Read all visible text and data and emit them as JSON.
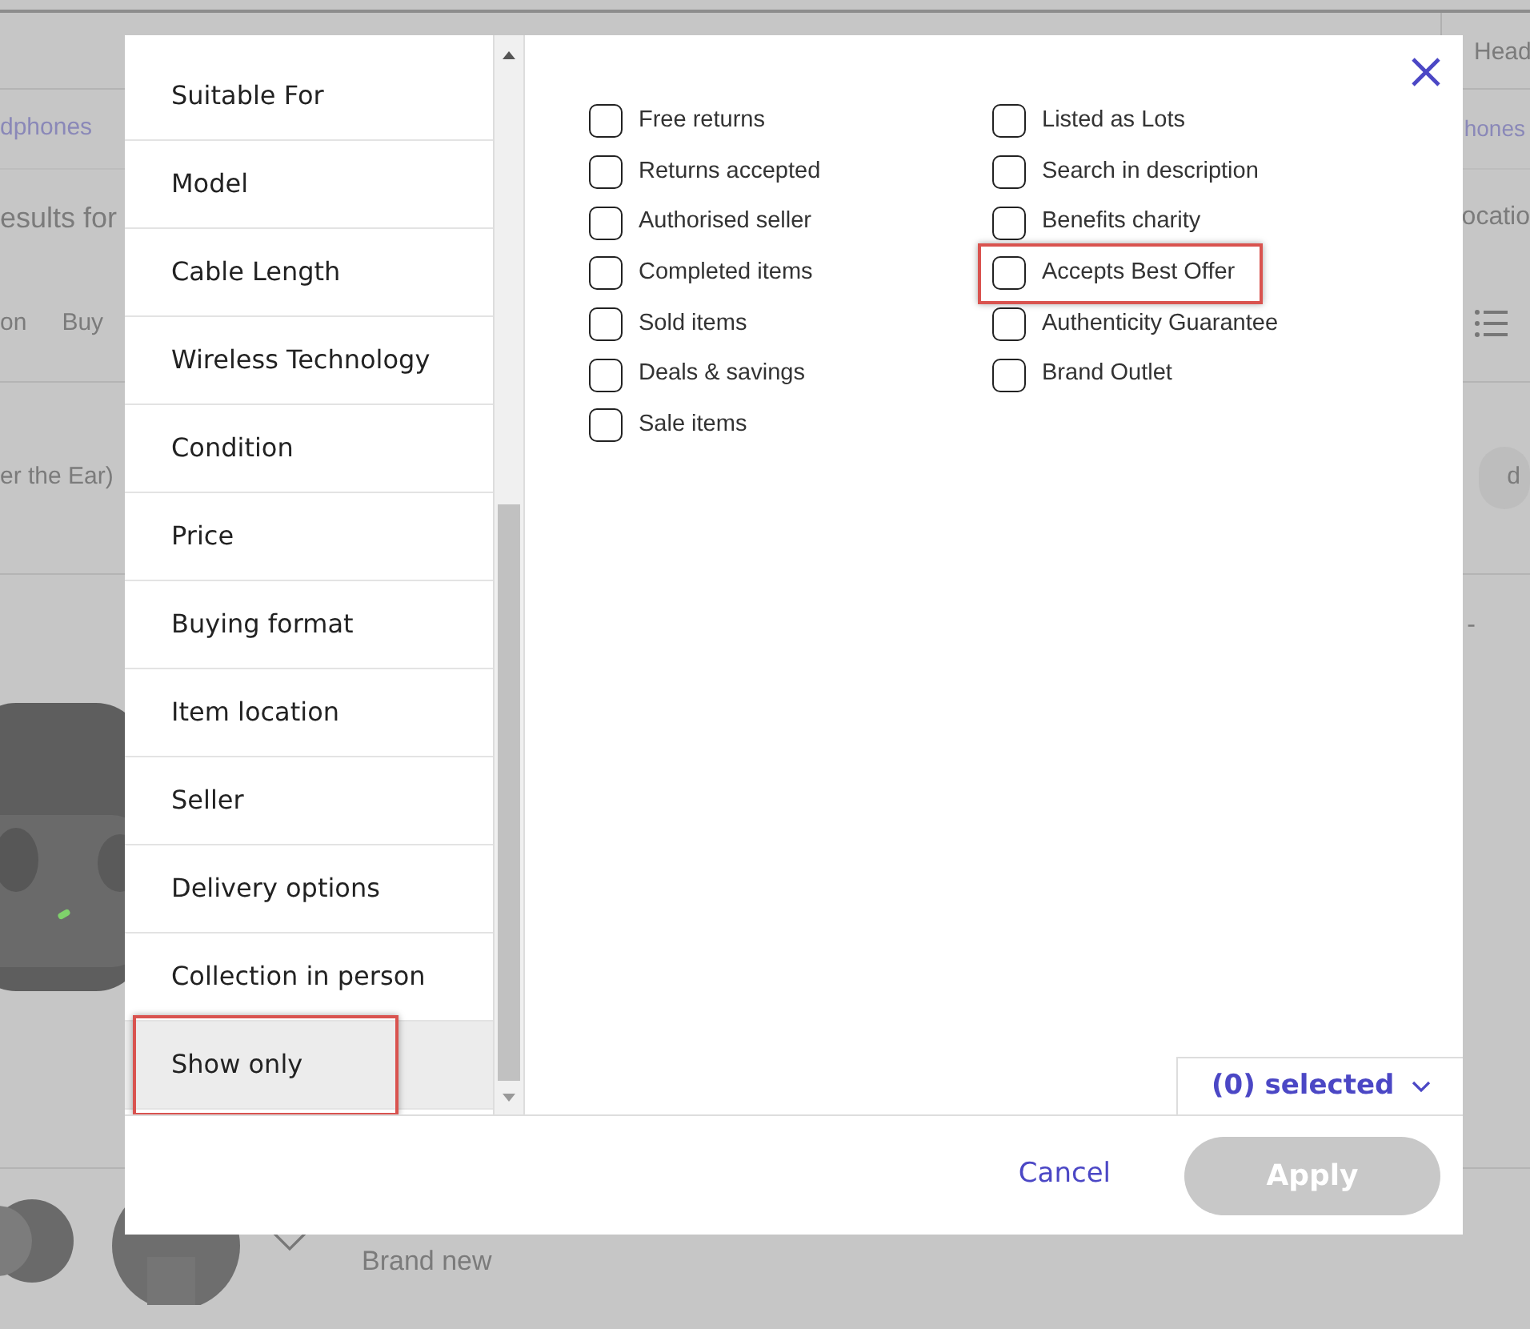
{
  "background_page": {
    "header_text": "Head",
    "links": [
      "dphones",
      "hones"
    ],
    "heading": "esults for",
    "heading_right": "ocatio",
    "tabs": [
      "on",
      "Buy"
    ],
    "chip_left": "er the Ear)",
    "chip_right": "d",
    "dash": "-",
    "condition": "Brand new"
  },
  "dialog": {
    "categories": [
      {
        "label": "Suitable For",
        "selected": false,
        "highlighted": false
      },
      {
        "label": "Model",
        "selected": false,
        "highlighted": false
      },
      {
        "label": "Cable Length",
        "selected": false,
        "highlighted": false
      },
      {
        "label": "Wireless Technology",
        "selected": false,
        "highlighted": false
      },
      {
        "label": "Condition",
        "selected": false,
        "highlighted": false
      },
      {
        "label": "Price",
        "selected": false,
        "highlighted": false
      },
      {
        "label": "Buying format",
        "selected": false,
        "highlighted": false
      },
      {
        "label": "Item location",
        "selected": false,
        "highlighted": false
      },
      {
        "label": "Seller",
        "selected": false,
        "highlighted": false
      },
      {
        "label": "Delivery options",
        "selected": false,
        "highlighted": false
      },
      {
        "label": "Collection in person",
        "selected": false,
        "highlighted": false
      },
      {
        "label": "Show only",
        "selected": true,
        "highlighted": true
      }
    ],
    "option_columns": [
      [
        {
          "label": "Free returns",
          "checked": false,
          "highlighted": false
        },
        {
          "label": "Returns accepted",
          "checked": false,
          "highlighted": false
        },
        {
          "label": "Authorised seller",
          "checked": false,
          "highlighted": false
        },
        {
          "label": "Completed items",
          "checked": false,
          "highlighted": false
        },
        {
          "label": "Sold items",
          "checked": false,
          "highlighted": false
        },
        {
          "label": "Deals & savings",
          "checked": false,
          "highlighted": false
        },
        {
          "label": "Sale items",
          "checked": false,
          "highlighted": false
        }
      ],
      [
        {
          "label": "Listed as Lots",
          "checked": false,
          "highlighted": false
        },
        {
          "label": "Search in description",
          "checked": false,
          "highlighted": false
        },
        {
          "label": "Benefits charity",
          "checked": false,
          "highlighted": false
        },
        {
          "label": "Accepts Best Offer",
          "checked": false,
          "highlighted": true
        },
        {
          "label": "Authenticity Guarantee",
          "checked": false,
          "highlighted": false
        },
        {
          "label": "Brand Outlet",
          "checked": false,
          "highlighted": false
        }
      ]
    ],
    "selected_count": "(0) selected",
    "cancel": "Cancel",
    "apply": {
      "label": "Apply",
      "disabled": true
    }
  }
}
